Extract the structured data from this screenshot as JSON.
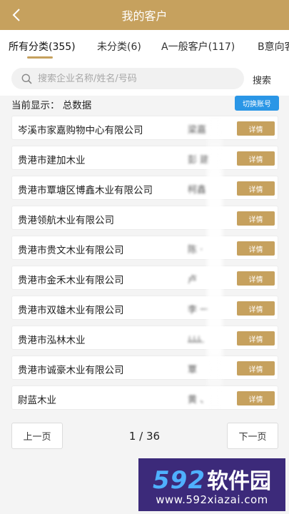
{
  "header": {
    "title": "我的客户",
    "back_icon": "chevron-left-icon"
  },
  "tabs": [
    {
      "label": "所有分类(355)"
    },
    {
      "label": "未分类(6)"
    },
    {
      "label": "A一般客户(117)"
    },
    {
      "label": "B意向客户"
    }
  ],
  "search": {
    "placeholder": "搜索企业名称/姓名/号码",
    "button_label": "搜索",
    "icon": "search-icon"
  },
  "current": {
    "label": "当前显示：  总数据",
    "switch_label": "切换账号"
  },
  "customers": [
    {
      "company": "岑溪市家嘉购物中心有限公司",
      "contact": "梁嘉",
      "detail_label": "详情"
    },
    {
      "company": "贵港市建加木业",
      "contact": "彭 建",
      "detail_label": "详情"
    },
    {
      "company": "贵港市覃塘区博鑫木业有限公司",
      "contact": "柯鑫",
      "detail_label": "详情"
    },
    {
      "company": "贵港领航木业有限公司",
      "contact": "",
      "detail_label": "详情"
    },
    {
      "company": "贵港市贵文木业有限公司",
      "contact": "陈 ·",
      "detail_label": "详情"
    },
    {
      "company": "贵港市金禾木业有限公司",
      "contact": "卢",
      "detail_label": "详情"
    },
    {
      "company": "贵港市双雄木业有限公司",
      "contact": "李 一",
      "detail_label": "详情"
    },
    {
      "company": "贵港市泓林木业",
      "contact": "ﾑﾑﾑ.",
      "detail_label": "详情"
    },
    {
      "company": "贵港市诚豪木业有限公司",
      "contact": "覃",
      "detail_label": "详情"
    },
    {
      "company": "尉蓝木业",
      "contact": "黄 、",
      "detail_label": "详情"
    }
  ],
  "pager": {
    "prev_label": "上一页",
    "page_indicator": "1 / 36",
    "next_label": "下一页"
  },
  "watermark": {
    "logo_number": "592",
    "logo_text": "软件园",
    "url": "www.592xiazai.com"
  },
  "colors": {
    "accent": "#c6a15e",
    "switch_button": "#2a96e6"
  }
}
